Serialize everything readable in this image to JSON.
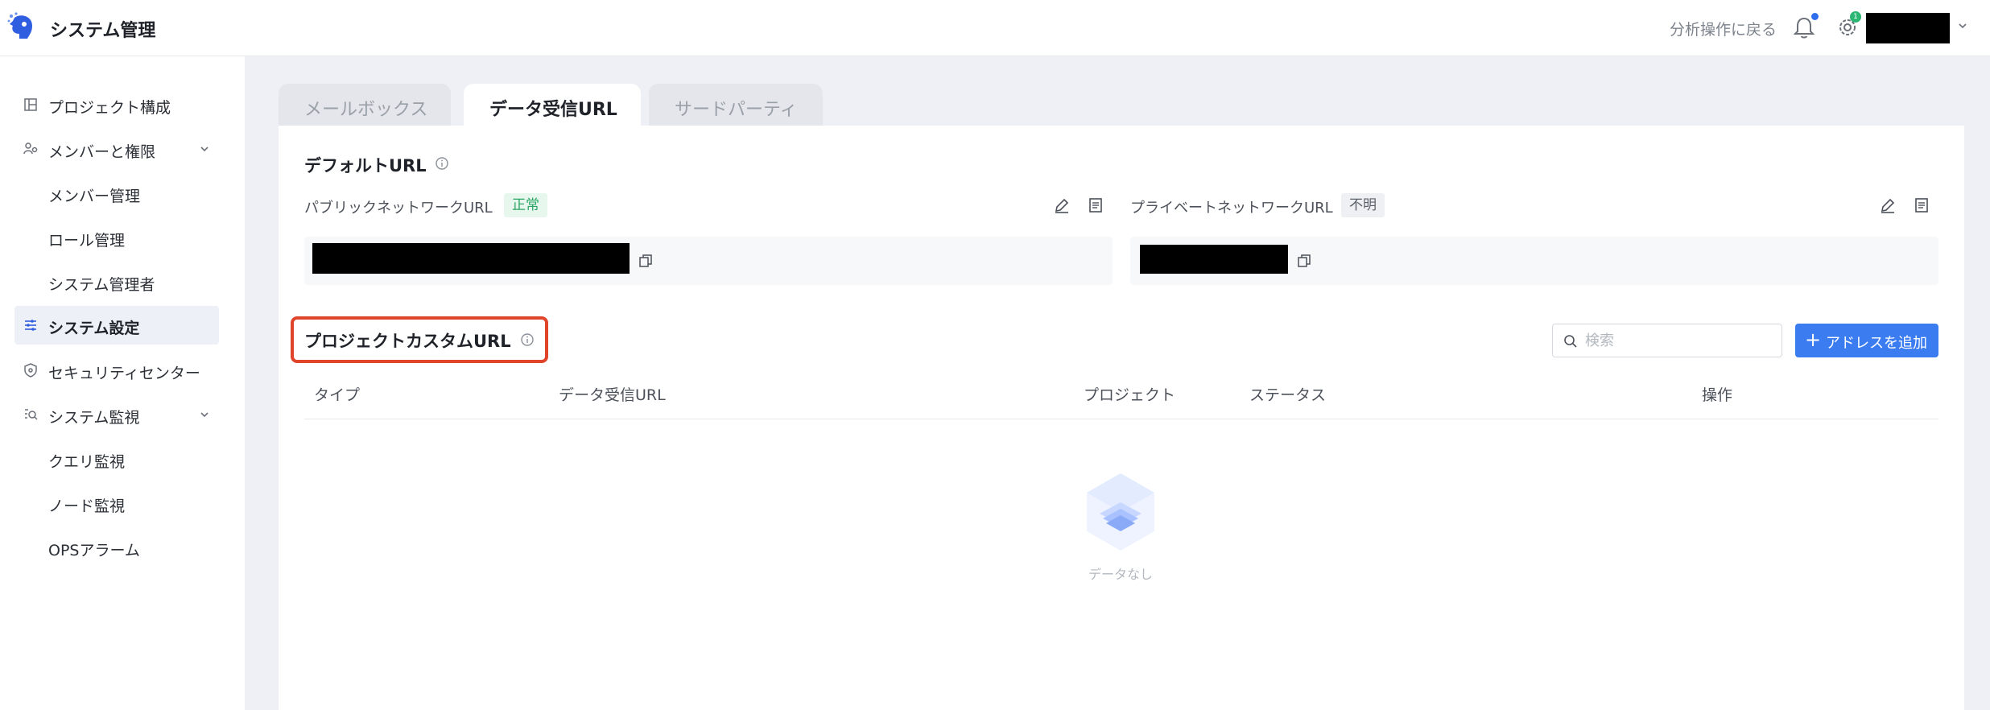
{
  "header": {
    "app_title": "システム管理",
    "back_link": "分析操作に戻る",
    "gear_badge": "1",
    "icons": [
      "logo-icon",
      "bell-icon",
      "gear-icon",
      "chevron-down-icon"
    ]
  },
  "sidebar": {
    "items": [
      {
        "label": "プロジェクト構成",
        "icon": "layout-icon"
      },
      {
        "label": "メンバーと権限",
        "icon": "members-icon",
        "expanded": true
      },
      {
        "label": "メンバー管理"
      },
      {
        "label": "ロール管理"
      },
      {
        "label": "システム管理者"
      },
      {
        "label": "システム設定",
        "icon": "sliders-icon",
        "active": true
      },
      {
        "label": "セキュリティセンター",
        "icon": "shield-icon"
      },
      {
        "label": "システム監視",
        "icon": "monitor-icon",
        "expanded": true
      },
      {
        "label": "クエリ監視"
      },
      {
        "label": "ノード監視"
      },
      {
        "label": "OPSアラーム"
      }
    ]
  },
  "tabs": [
    {
      "label": "メールボックス",
      "active": false
    },
    {
      "label": "データ受信URL",
      "active": true
    },
    {
      "label": "サードパーティ",
      "active": false
    }
  ],
  "default_url": {
    "title": "デフォルトURL",
    "public": {
      "label": "パブリックネットワークURL",
      "status": "正常"
    },
    "private": {
      "label": "プライベートネットワークURL",
      "status": "不明"
    }
  },
  "custom_url": {
    "title": "プロジェクトカスタムURL",
    "search_placeholder": "検索",
    "add_button": "アドレスを追加",
    "columns": [
      "タイプ",
      "データ受信URL",
      "プロジェクト",
      "ステータス",
      "操作"
    ],
    "rows": [],
    "empty_text": "データなし"
  },
  "colors": {
    "accent": "#3b7cf0",
    "status_ok": "#2ba566",
    "highlight": "#e0452b"
  }
}
